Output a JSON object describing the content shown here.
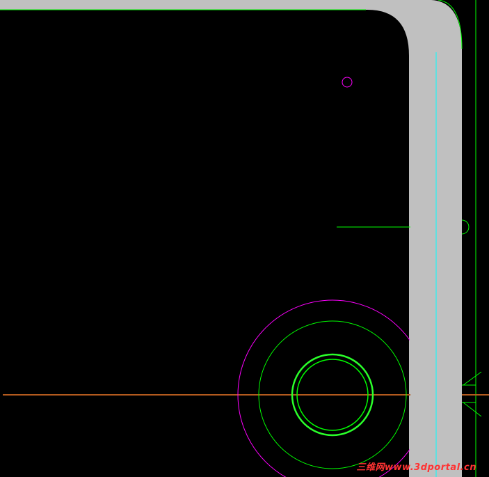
{
  "colors": {
    "background": "#000000",
    "part": "#c0c0c0",
    "green": "#00ff00",
    "bright_green": "#2aff2a",
    "magenta": "#ff00ff",
    "cyan": "#00ffff",
    "brown": "#b25a1e",
    "watermark": "#ff3333"
  },
  "watermark": {
    "text": "三维网www.3dportal.cn"
  },
  "layers": {
    "outline": "green",
    "hidden_holes": "magenta",
    "center_lines": "cyan",
    "axis": "brown"
  }
}
